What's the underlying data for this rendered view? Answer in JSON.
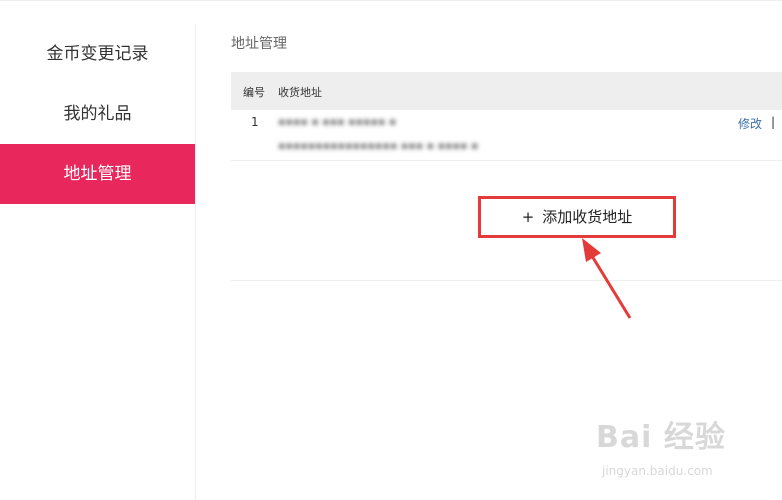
{
  "sidebar": {
    "items": [
      {
        "label": "金币变更记录",
        "active": false
      },
      {
        "label": "我的礼品",
        "active": false
      },
      {
        "label": "地址管理",
        "active": true
      }
    ]
  },
  "main": {
    "title": "地址管理",
    "table": {
      "headers": [
        "编号",
        "收货地址"
      ],
      "rows": [
        {
          "number": "1",
          "address_line1": "▪▪▪▪ ▪ ▪▪▪ ▪▪▪▪▪ ▪",
          "address_line2": "▪▪▪▪▪▪▪▪▪▪▪▪▪▪▪▪ ▪▪▪ ▪ ▪▪▪▪ ▪",
          "actions": {
            "edit": "修改",
            "separator": "|"
          }
        }
      ]
    },
    "add_button": {
      "icon": "+",
      "label": "添加收货地址"
    }
  },
  "annotation": {
    "color": "#e53a3a"
  },
  "watermark": {
    "brand": "Bai 经验",
    "url": "jingyan.baidu.com"
  },
  "colors": {
    "accent": "#e8285c",
    "link": "#3b6fb0"
  }
}
